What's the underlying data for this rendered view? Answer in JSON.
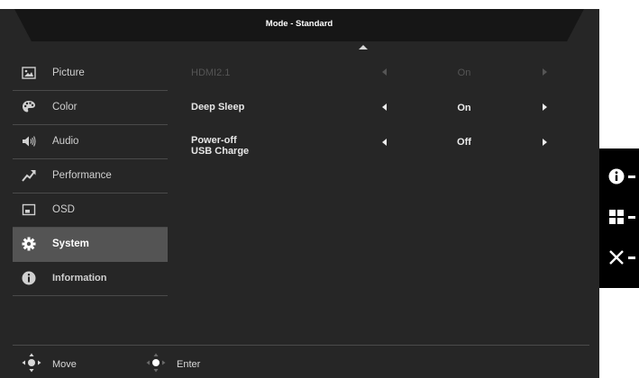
{
  "header": {
    "title": "Mode - Standard"
  },
  "sidebar": {
    "items": [
      {
        "label": "Picture",
        "icon": "picture-icon",
        "selected": false
      },
      {
        "label": "Color",
        "icon": "palette-icon",
        "selected": false
      },
      {
        "label": "Audio",
        "icon": "speaker-icon",
        "selected": false
      },
      {
        "label": "Performance",
        "icon": "trend-arrow-icon",
        "selected": false
      },
      {
        "label": "OSD",
        "icon": "osd-icon",
        "selected": false
      },
      {
        "label": "System",
        "icon": "gear-icon",
        "selected": true
      },
      {
        "label": "Information",
        "icon": "info-icon",
        "selected": false
      }
    ]
  },
  "settings": {
    "rows": [
      {
        "label": "HDMI2.1",
        "value": "On",
        "enabled": false
      },
      {
        "label": "Deep Sleep",
        "value": "On",
        "enabled": true
      },
      {
        "label_line1": "Power-off",
        "label_line2": "USB Charge",
        "value": "Off",
        "enabled": true
      }
    ]
  },
  "footer": {
    "move_label": "Move",
    "enter_label": "Enter"
  },
  "keypad": {
    "keys": [
      "info-icon",
      "grid-icon",
      "close-icon"
    ]
  },
  "colors": {
    "panel": "#262626",
    "titlebar": "#161616",
    "selected": "#545454",
    "disabled": "#555555"
  }
}
